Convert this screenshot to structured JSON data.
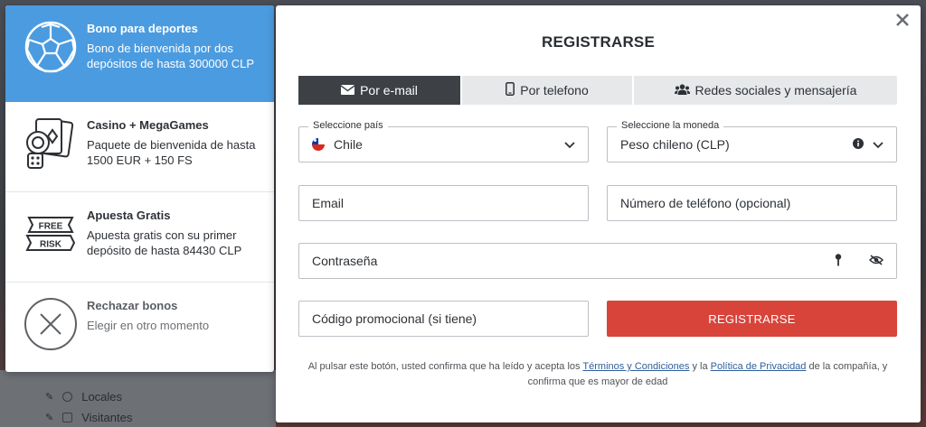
{
  "background": {
    "rows": [
      "Locales",
      "Visitantes"
    ]
  },
  "bonuses": [
    {
      "title": "Bono para deportes",
      "desc": "Bono de bienvenida por dos depósitos de hasta 300000 CLP",
      "icon": "soccer-ball-icon",
      "active": true
    },
    {
      "title": "Casino + MegaGames",
      "desc": "Paquete de bienvenida de hasta 1500 EUR + 150 FS",
      "icon": "casino-cards-icon",
      "active": false
    },
    {
      "title": "Apuesta Gratis",
      "desc": "Apuesta gratis con su primer depósito de hasta 84430 CLP",
      "icon": "free-risk-tickets-icon",
      "active": false,
      "icon_labels": [
        "FREE",
        "RISK"
      ]
    },
    {
      "title": "Rechazar bonos",
      "desc": "Elegir en otro momento",
      "icon": "reject-circle-x-icon",
      "active": false
    }
  ],
  "modal": {
    "title": "REGISTRARSE",
    "tabs": [
      {
        "label": "Por e-mail",
        "icon": "envelope-icon",
        "active": true
      },
      {
        "label": "Por telefono",
        "icon": "mobile-phone-icon",
        "active": false
      },
      {
        "label": "Redes sociales y mensajería",
        "icon": "users-icon",
        "active": false
      }
    ],
    "country": {
      "legend": "Seleccione país",
      "value": "Chile"
    },
    "currency": {
      "legend": "Seleccione la moneda",
      "value": "Peso chileno (CLP)"
    },
    "email": {
      "placeholder": "Email"
    },
    "phone": {
      "placeholder": "Número de teléfono (opcional)"
    },
    "password": {
      "placeholder": "Contraseña"
    },
    "promo": {
      "placeholder": "Código promocional (si tiene)"
    },
    "submit_label": "REGISTRARSE",
    "terms": {
      "prefix": "Al pulsar este botón, usted confirma que ha leído y acepta los ",
      "link1": "Términos y Condiciones",
      "middle": " y la ",
      "link2": "Política de Privacidad",
      "suffix": " de la compañía, y confirma que es mayor de edad"
    }
  },
  "colors": {
    "accent_blue": "#4b9be0",
    "submit_red": "#d9443a",
    "tab_active": "#3d4146"
  }
}
